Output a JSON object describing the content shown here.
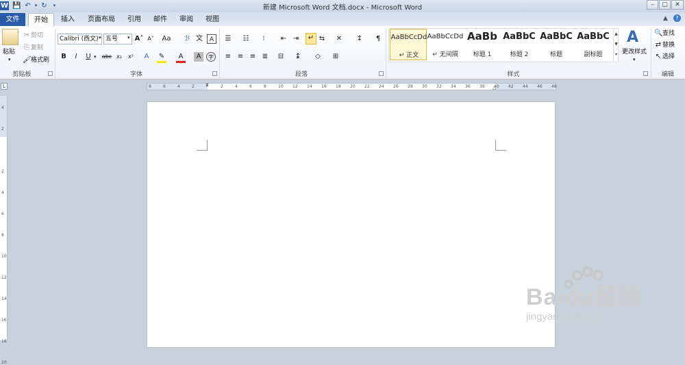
{
  "window": {
    "title": "新建 Microsoft Word 文档.docx - Microsoft Word",
    "controls": [
      "–",
      "▢",
      "✕"
    ]
  },
  "tabs": [
    {
      "label": "文件"
    },
    {
      "label": "开始"
    },
    {
      "label": "插入"
    },
    {
      "label": "页面布局"
    },
    {
      "label": "引用"
    },
    {
      "label": "邮件"
    },
    {
      "label": "审阅"
    },
    {
      "label": "视图"
    }
  ],
  "clipboard": {
    "paste": "粘贴",
    "cut": "剪切",
    "copy": "复制",
    "format_painter": "格式刷",
    "group": "剪贴板"
  },
  "font": {
    "name": "Calibri (西文)",
    "size": "五号",
    "group": "字体",
    "buttons": [
      "B",
      "I",
      "U",
      "abc",
      "x₂",
      "x²"
    ]
  },
  "paragraph": {
    "group": "段落"
  },
  "styles": {
    "group": "样式",
    "items": [
      {
        "sample": "AaBbCcDd",
        "name": "↵ 正文"
      },
      {
        "sample": "AaBbCcDd",
        "name": "↵ 无间隔"
      },
      {
        "sample": "AaBb",
        "name": "标题 1"
      },
      {
        "sample": "AaBbC",
        "name": "标题 2"
      },
      {
        "sample": "AaBbC",
        "name": "标题"
      },
      {
        "sample": "AaBbC",
        "name": "副标题"
      }
    ],
    "change": "更改样式"
  },
  "editing": {
    "group": "编辑",
    "find": "查找",
    "replace": "替换",
    "select": "选择"
  },
  "ruler": {
    "h_ticks": [
      "8",
      "6",
      "4",
      "2",
      "",
      "2",
      "4",
      "6",
      "8",
      "10",
      "12",
      "14",
      "16",
      "18",
      "20",
      "22",
      "24",
      "26",
      "28",
      "30",
      "32",
      "34",
      "36",
      "38",
      "40",
      "42",
      "44",
      "46",
      "48"
    ],
    "v_ticks": [
      "4",
      "2",
      "",
      "2",
      "4",
      "6",
      "8",
      "10",
      "12",
      "14",
      "16",
      "18",
      "20"
    ]
  },
  "watermark": {
    "brand": "Baidu经验",
    "url": "jingyan.baidu.com"
  },
  "colors": {
    "file_tab": "#2a5ba8",
    "selected_style": "#f5c842"
  }
}
